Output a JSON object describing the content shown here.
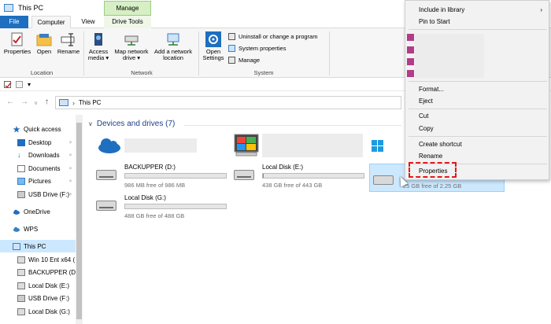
{
  "window": {
    "title": "This PC"
  },
  "context_tab": "Manage",
  "tabs": [
    "File",
    "Computer",
    "View",
    "Drive Tools"
  ],
  "ribbon": {
    "location": {
      "label": "Location",
      "buttons": [
        "Properties",
        "Open",
        "Rename"
      ]
    },
    "network": {
      "label": "Network",
      "buttons": [
        "Access media ▾",
        "Map network drive ▾",
        "Add a network location"
      ]
    },
    "system": {
      "label": "System",
      "open_settings": "Open Settings",
      "small": [
        "Uninstall or change a program",
        "System properties",
        "Manage"
      ]
    }
  },
  "address": {
    "location": "This PC"
  },
  "nav": [
    {
      "label": "Quick access",
      "icon": "star-icon",
      "pin": false
    },
    {
      "label": "Desktop",
      "icon": "desktop-icon",
      "pin": true
    },
    {
      "label": "Downloads",
      "icon": "download-icon",
      "pin": true
    },
    {
      "label": "Documents",
      "icon": "documents-icon",
      "pin": true
    },
    {
      "label": "Pictures",
      "icon": "pictures-icon",
      "pin": true
    },
    {
      "label": "USB Drive (F:)",
      "icon": "usb-drive-icon",
      "pin": true
    },
    {
      "label": "OneDrive",
      "icon": "cloud-icon",
      "pin": false
    },
    {
      "label": "WPS",
      "icon": "cloud-icon",
      "pin": false
    },
    {
      "label": "This PC",
      "icon": "computer-icon",
      "pin": false
    },
    {
      "label": "Win 10 Ent x64 (",
      "icon": "drive-icon",
      "pin": false
    },
    {
      "label": "BACKUPPER (D:)",
      "icon": "drive-icon",
      "pin": false
    },
    {
      "label": "Local Disk (E:)",
      "icon": "drive-icon",
      "pin": false
    },
    {
      "label": "USB Drive (F:)",
      "icon": "usb-drive-icon",
      "pin": false
    },
    {
      "label": "Local Disk (G:)",
      "icon": "drive-icon",
      "pin": false
    }
  ],
  "section": {
    "title": "Devices and drives (7)"
  },
  "drives": [
    {
      "name": "BACKUPPER (D:)",
      "free": "986 MB free of 986 MB",
      "used_fraction": 0.0
    },
    {
      "name": "Local Disk (E:)",
      "free": "438 GB free of 443 GB",
      "used_fraction": 0.011
    },
    {
      "name": "Local Disk (G:)",
      "free": "488 GB free of 488 GB",
      "used_fraction": 0.0
    }
  ],
  "selected_drive_free": "25 GB free of 2.25 GB",
  "context_menu": {
    "include_in_library": "Include in library",
    "pin_to_start": "Pin to Start",
    "format": "Format...",
    "eject": "Eject",
    "cut": "Cut",
    "copy": "Copy",
    "create_shortcut": "Create shortcut",
    "rename": "Rename",
    "properties": "Properties"
  },
  "colors": {
    "accent": "#1e6fbf",
    "manage_tab": "#d6efc4",
    "selected": "#cce8ff",
    "highlight": "#e01b1b",
    "bar_fill": "#26a0da"
  }
}
